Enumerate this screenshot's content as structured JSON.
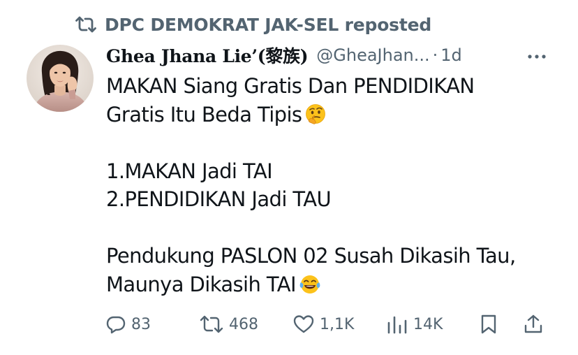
{
  "repost": {
    "icon": "repost-icon",
    "text": "DPC DEMOKRAT JAK-SEL reposted"
  },
  "author": {
    "display_name": "Ghea Jhana Lie’(黎族)",
    "handle": "@GheaJhan...",
    "separator": "·",
    "time": "1d",
    "avatar": "profile-photo"
  },
  "tweet": {
    "lines": [
      "MAKAN Siang Gratis Dan PENDIDIKAN",
      "Gratis Itu Beda Tipis",
      "",
      "1.MAKAN Jadi TAI",
      "2.PENDIDIKAN Jadi TAU",
      "",
      "Pendukung PASLON 02 Susah Dikasih Tau,",
      "Maunya Dikasih TAI"
    ],
    "emoji_thinking": "thinking-face-emoji",
    "emoji_laughing": "tears-of-joy-emoji"
  },
  "actions": {
    "replies": "83",
    "reposts": "468",
    "likes": "1,1K",
    "views": "14K",
    "icons": [
      "reply-icon",
      "repost-icon",
      "like-icon",
      "views-icon",
      "bookmark-icon",
      "share-icon"
    ]
  },
  "colors": {
    "text": "#0f1419",
    "secondary": "#536471",
    "background": "#ffffff"
  }
}
